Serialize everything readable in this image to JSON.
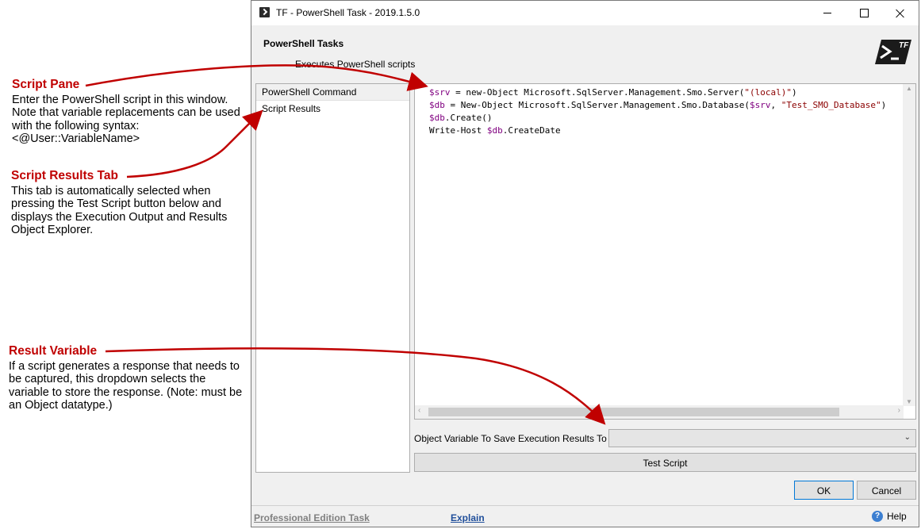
{
  "window": {
    "title": "TF - PowerShell Task - 2019.1.5.0",
    "header_title": "PowerShell Tasks",
    "header_subtitle": "Executes PowerShell scripts",
    "logo_text": "TF"
  },
  "nav": {
    "items": [
      {
        "label": "PowerShell Command"
      },
      {
        "label": "Script Results"
      }
    ]
  },
  "editor": {
    "lines": [
      "$srv = new-Object Microsoft.SqlServer.Management.Smo.Server(\"(local)\")",
      "$db = New-Object Microsoft.SqlServer.Management.Smo.Database($srv, \"Test_SMO_Database\")",
      "$db.Create()",
      "Write-Host $db.CreateDate"
    ]
  },
  "form": {
    "object_variable_label": "Object Variable To Save Execution Results To",
    "object_variable_value": "",
    "test_script_label": "Test Script",
    "ok_label": "OK",
    "cancel_label": "Cancel"
  },
  "footer": {
    "edition_link": "Professional Edition Task",
    "explain_link": "Explain",
    "help_label": "Help"
  },
  "annotations": [
    {
      "heading": "Script Pane",
      "body": "Enter the PowerShell script in this window. Note that variable replacements can be used with the following syntax: <@User::VariableName>"
    },
    {
      "heading": "Script Results Tab",
      "body": "This tab is automatically selected when pressing the Test Script button below and displays the Execution Output and Results Object Explorer."
    },
    {
      "heading": "Result Variable",
      "body": "If a script generates a response that needs to be captured, this dropdown selects the variable to store the response. (Note: must be an Object datatype.)"
    }
  ],
  "colors": {
    "annotation_heading": "#c00000",
    "arrow": "#c00000",
    "variable": "#800080",
    "string": "#8b0000",
    "link": "#1f4e9a"
  }
}
